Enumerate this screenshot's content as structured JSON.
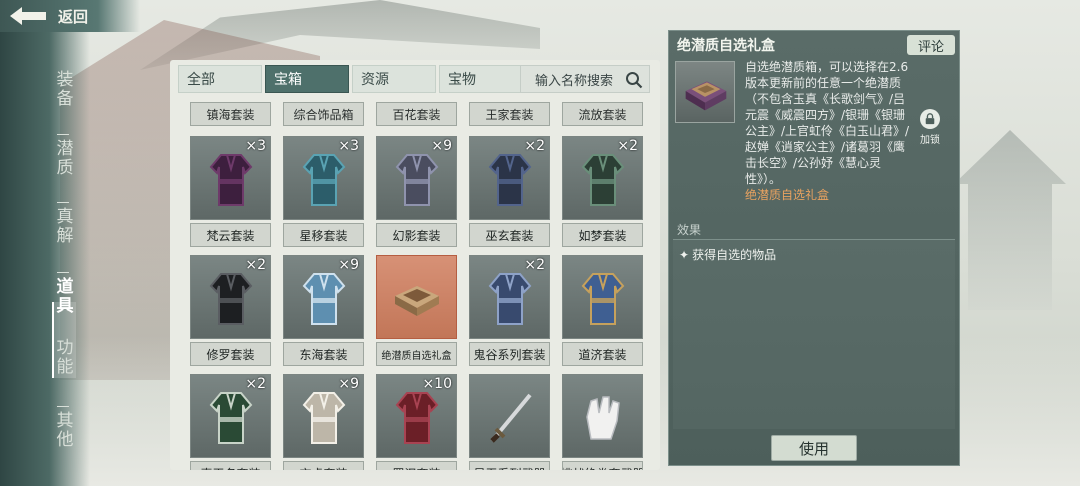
{
  "header": {
    "back_label": "返回"
  },
  "sidebar": {
    "items": [
      {
        "label": "装备"
      },
      {
        "label": "潜质"
      },
      {
        "label": "真解"
      },
      {
        "label": "道具",
        "active": true
      },
      {
        "label": "功能"
      },
      {
        "label": "其他"
      }
    ]
  },
  "inventory": {
    "tabs": [
      {
        "label": "全部"
      },
      {
        "label": "宝箱",
        "active": true
      },
      {
        "label": "资源"
      },
      {
        "label": "宝物"
      }
    ],
    "search_placeholder": "输入名称搜索",
    "top_row_labels": [
      "镇海套装",
      "综合饰品箱",
      "百花套装",
      "王家套装",
      "流放套装"
    ],
    "items": [
      {
        "name": "梵云套装",
        "count": "×3",
        "art": "robe-dark-purple"
      },
      {
        "name": "星移套装",
        "count": "×3",
        "art": "robe-teal"
      },
      {
        "name": "幻影套装",
        "count": "×9",
        "art": "jacket-gray"
      },
      {
        "name": "巫玄套装",
        "count": "×2",
        "art": "jacket-blue"
      },
      {
        "name": "如梦套装",
        "count": "×2",
        "art": "robe-green"
      },
      {
        "name": "修罗套装",
        "count": "×2",
        "art": "armor-black"
      },
      {
        "name": "东海套装",
        "count": "×9",
        "art": "robe-light-blue"
      },
      {
        "name": "绝潜质自选礼盒",
        "count": "",
        "art": "gift-box",
        "selected": true
      },
      {
        "name": "鬼谷系列套装",
        "count": "×2",
        "art": "robe-navy"
      },
      {
        "name": "道济套装",
        "count": "",
        "art": "robe-blue-belt"
      },
      {
        "name": "真王名套装",
        "count": "×2",
        "art": "robe-green-dark"
      },
      {
        "name": "玄虎套装",
        "count": "×9",
        "art": "robe-white"
      },
      {
        "name": "罗汉套装",
        "count": "×10",
        "art": "robe-red"
      },
      {
        "name": "星吞系列武器",
        "count": "",
        "art": "sword"
      },
      {
        "name": "挑战绝卷套武器",
        "count": "",
        "art": "glove"
      }
    ]
  },
  "detail": {
    "title": "绝潜质自选礼盒",
    "comment_label": "评论",
    "lock_label": "加锁",
    "description": "自选绝潜质箱，可以选择在2.6版本更新前的任意一个绝潜质（不包含玉真《长歌剑气》/吕元震《威震四方》/银珊《银珊公主》/上官虹伶《白玉山君》/赵婵《逍家公主》/诸葛羽《鹰击长空》/公孙妤《慧心灵性》）。",
    "highlight": "绝潜质自选礼盒",
    "effect_label": "效果",
    "effect_text": "获得自选的物品",
    "use_label": "使用"
  },
  "colors": {
    "accent": "#4e706b",
    "selected_slot": "#d79176",
    "highlight_text": "#e8a260"
  }
}
